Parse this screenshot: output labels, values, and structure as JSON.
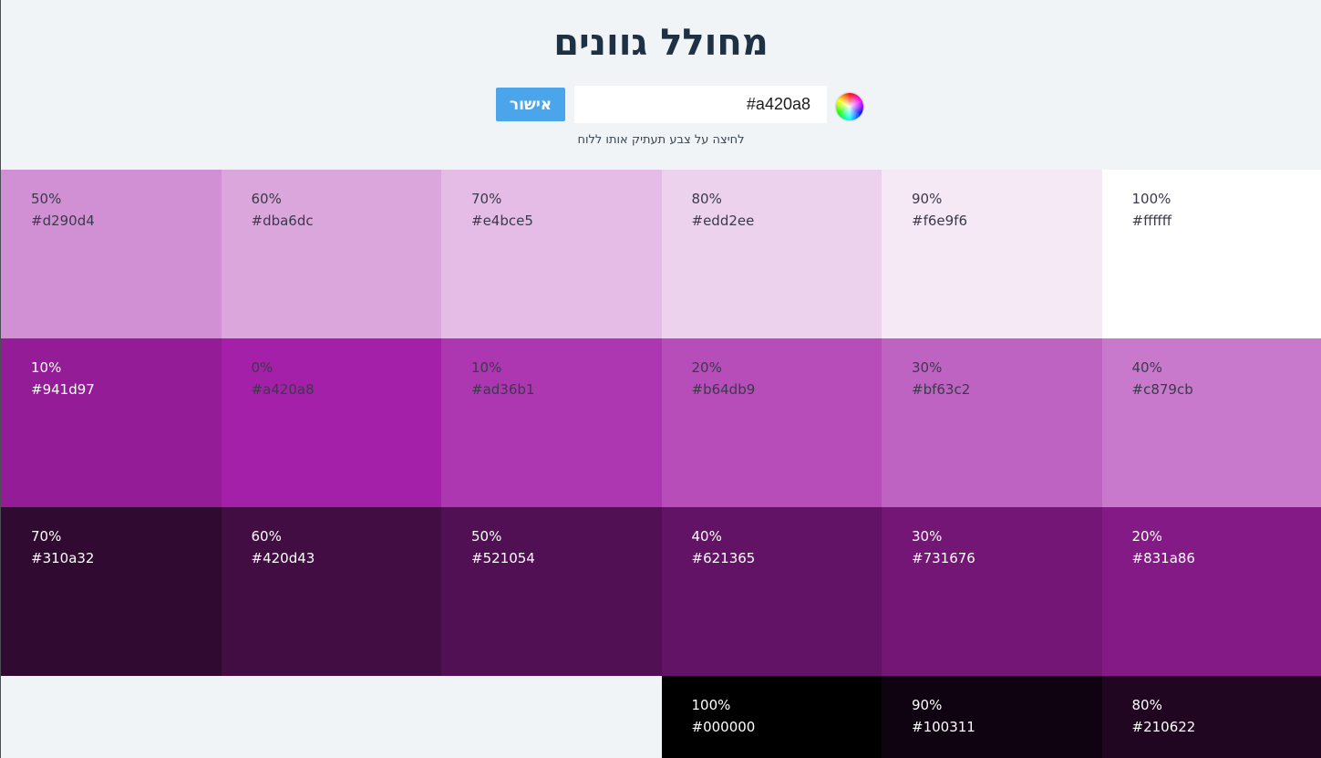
{
  "app": {
    "title": "מחולל גוונים",
    "confirm_label": "אישור",
    "input_value": "#a420a8",
    "hint": "לחיצה על צבע תעתיק אותו ללוח"
  },
  "icons": {
    "color_picker": "color-wheel-icon"
  },
  "colors": {
    "accent": "#4aa5ea",
    "background": "#f0f4f7",
    "title": "#1e3044"
  },
  "rows": [
    [
      {
        "pct": "50%",
        "hex": "#d290d4"
      },
      {
        "pct": "60%",
        "hex": "#dba6dc"
      },
      {
        "pct": "70%",
        "hex": "#e4bce5"
      },
      {
        "pct": "80%",
        "hex": "#edd2ee"
      },
      {
        "pct": "90%",
        "hex": "#f6e9f6"
      },
      {
        "pct": "100%",
        "hex": "#ffffff"
      }
    ],
    [
      {
        "pct": "10%",
        "hex": "#941d97"
      },
      {
        "pct": "0%",
        "hex": "#a420a8"
      },
      {
        "pct": "10%",
        "hex": "#ad36b1"
      },
      {
        "pct": "20%",
        "hex": "#b64db9"
      },
      {
        "pct": "30%",
        "hex": "#bf63c2"
      },
      {
        "pct": "40%",
        "hex": "#c879cb"
      }
    ],
    [
      {
        "pct": "70%",
        "hex": "#310a32"
      },
      {
        "pct": "60%",
        "hex": "#420d43"
      },
      {
        "pct": "50%",
        "hex": "#521054"
      },
      {
        "pct": "40%",
        "hex": "#621365"
      },
      {
        "pct": "30%",
        "hex": "#731676"
      },
      {
        "pct": "20%",
        "hex": "#831a86"
      }
    ],
    [
      {
        "pct": "100%",
        "hex": "#000000"
      },
      {
        "pct": "90%",
        "hex": "#100311"
      },
      {
        "pct": "80%",
        "hex": "#210622"
      }
    ]
  ]
}
